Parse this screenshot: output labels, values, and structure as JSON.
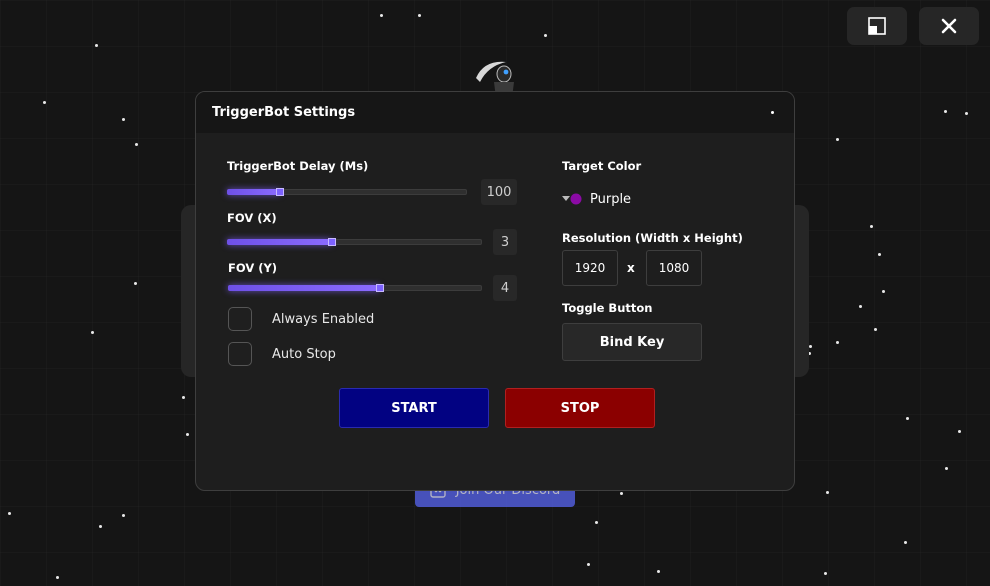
{
  "window_controls": {
    "restore_icon": "restore-window-icon",
    "close_icon": "close-x-icon"
  },
  "dialog": {
    "title": "TriggerBot Settings",
    "menu_icon": "dot-menu-icon"
  },
  "sliders": [
    {
      "id": "delay",
      "label": "TriggerBot Delay (Ms)",
      "value": "100",
      "fill": 0.22
    },
    {
      "id": "fov-x",
      "label": "FOV (X)",
      "value": "3",
      "fill": 0.41
    },
    {
      "id": "fov-y",
      "label": "FOV (Y)",
      "value": "4",
      "fill": 0.6
    }
  ],
  "checkboxes": [
    {
      "label": "Always Enabled",
      "checked": false
    },
    {
      "label": "Auto Stop",
      "checked": false
    }
  ],
  "target_color": {
    "label": "Target Color",
    "selected": "Purple",
    "swatch": "#8b0aa5",
    "icon": "dropdown-arrow-icon"
  },
  "resolution": {
    "label": "Resolution (Width x Height)",
    "width": "1920",
    "separator": "x",
    "height": "1080"
  },
  "toggle": {
    "label": "Toggle Button",
    "bind_label": "Bind Key"
  },
  "actions": {
    "start_label": "START",
    "start_color": "#020282",
    "stop_label": "STOP",
    "stop_color": "#8b0000"
  },
  "background": {
    "discord_label": "Join Our Discord",
    "discord_icon": "discord-icon"
  }
}
